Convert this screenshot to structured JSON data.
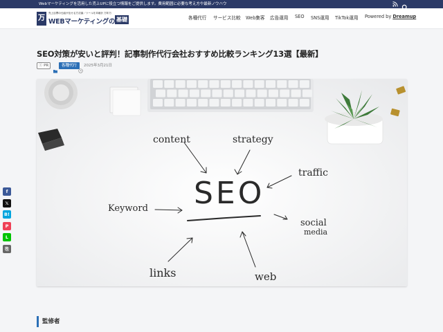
{
  "topbar": {
    "message": "Webマーケティングを活用した売上UPに役立つ情報をご提供します。費用範囲に必要な考え方や最新ノウハウ",
    "rss_icon": "rss-icon",
    "search_icon": "search-icon"
  },
  "logo": {
    "mark": "万",
    "tagline": "売上目標の仕組が出せる方法論／ツールを本格計 万年万",
    "name": "WEBマーケティングの",
    "badge": "基礎"
  },
  "nav": {
    "items": [
      "各種代行",
      "サービス比較",
      "Web集客",
      "広告運用",
      "SEO",
      "SNS運用",
      "TikTok運用"
    ],
    "powered_prefix": "Powered by ",
    "powered_brand": "Dreamup"
  },
  "article": {
    "title": "SEO対策が安いと評判！記事制作代行会社おすすめ比較ランキング13選【最新】",
    "pr_label": "PR",
    "category": "各種代行",
    "date": "2025年3月21日"
  },
  "hero": {
    "center_word": "SEO",
    "words": [
      "content",
      "strategy",
      "traffic",
      "Keyword",
      "social",
      "media",
      "links",
      "web"
    ]
  },
  "share": {
    "buttons": [
      {
        "name": "facebook",
        "label": "f",
        "color": "#3b5998"
      },
      {
        "name": "x",
        "label": "𝕏",
        "color": "#111111"
      },
      {
        "name": "hatena",
        "label": "B!",
        "color": "#00a4de"
      },
      {
        "name": "pocket",
        "label": "P",
        "color": "#ef4056"
      },
      {
        "name": "line",
        "label": "L",
        "color": "#00c300"
      },
      {
        "name": "copy",
        "label": "⎘",
        "color": "#666666"
      }
    ]
  },
  "supervisor": {
    "heading": "監修者"
  },
  "colors": {
    "brand": "#2b3a67",
    "accent": "#2b6fb6"
  }
}
